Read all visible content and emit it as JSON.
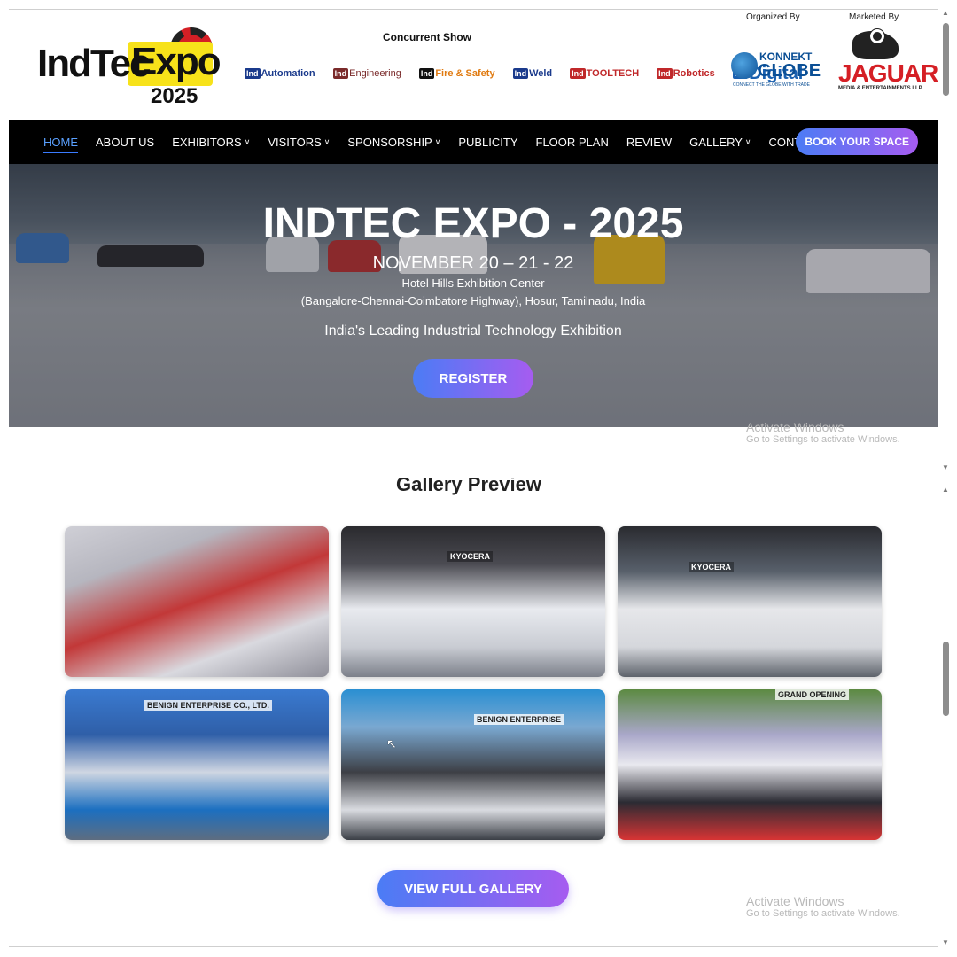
{
  "header": {
    "logo": {
      "part1": "IndTec",
      "part2": "Expo",
      "year": "2025"
    },
    "concurrent_label": "Concurrent Show",
    "organized_by_label": "Organized By",
    "marketed_by_label": "Marketed By",
    "show_logos": [
      {
        "badge": "Ind",
        "text": "Automation",
        "color": "#1a3a8c"
      },
      {
        "badge": "Ind",
        "text": "Engineering",
        "color": "#7a2a2a"
      },
      {
        "badge": "Ind",
        "text": "Fire & Safety",
        "color": "#e07a10"
      },
      {
        "badge": "Ind",
        "text": "Weld",
        "color": "#1a3a8c"
      },
      {
        "badge": "Ind",
        "text": "TOOLTECH",
        "color": "#c0282a"
      },
      {
        "badge": "Ind",
        "text": "Robotics",
        "color": "#c0282a"
      },
      {
        "badge": "Ind",
        "text": "Digital",
        "color": "#1a60b0"
      }
    ],
    "organizer": {
      "line1": "KONNEKT",
      "line2": "GLOBE",
      "tagline": "CONNECT THE GLOBE WITH TRADE"
    },
    "marketer": {
      "name": "JAGUAR",
      "tagline": "MEDIA & ENTERTAINMENTS LLP"
    }
  },
  "nav": {
    "items": [
      {
        "label": "HOME",
        "dropdown": false,
        "active": true
      },
      {
        "label": "ABOUT US",
        "dropdown": false
      },
      {
        "label": "EXHIBITORS",
        "dropdown": true
      },
      {
        "label": "VISITORS",
        "dropdown": true
      },
      {
        "label": "SPONSORSHIP",
        "dropdown": true
      },
      {
        "label": "PUBLICITY",
        "dropdown": false
      },
      {
        "label": "FLOOR PLAN",
        "dropdown": false
      },
      {
        "label": "REVIEW",
        "dropdown": false
      },
      {
        "label": "GALLERY",
        "dropdown": true
      },
      {
        "label": "CONTACT US",
        "dropdown": false
      }
    ],
    "cta": "BOOK YOUR SPACE"
  },
  "hero": {
    "title": "INDTEC EXPO - 2025",
    "dates": "NOVEMBER 20 – 21 - 22",
    "venue": "Hotel Hills Exhibition Center",
    "address": "(Bangalore-Chennai-Coimbatore Highway), Hosur, Tamilnadu, India",
    "tagline": "India's Leading Industrial Technology Exhibition",
    "register": "REGISTER"
  },
  "watermark": {
    "line1": "Activate Windows",
    "line2": "Go to Settings to activate Windows."
  },
  "gallery": {
    "title": "Gallery Preview",
    "tiles": [
      {
        "label": ""
      },
      {
        "label": "KYOCERA"
      },
      {
        "label": "KYOCERA"
      },
      {
        "label": "BENIGN ENTERPRISE CO., LTD."
      },
      {
        "label": "BENIGN ENTERPRISE"
      },
      {
        "label": "GRAND OPENING"
      }
    ],
    "view_all": "VIEW FULL GALLERY"
  }
}
